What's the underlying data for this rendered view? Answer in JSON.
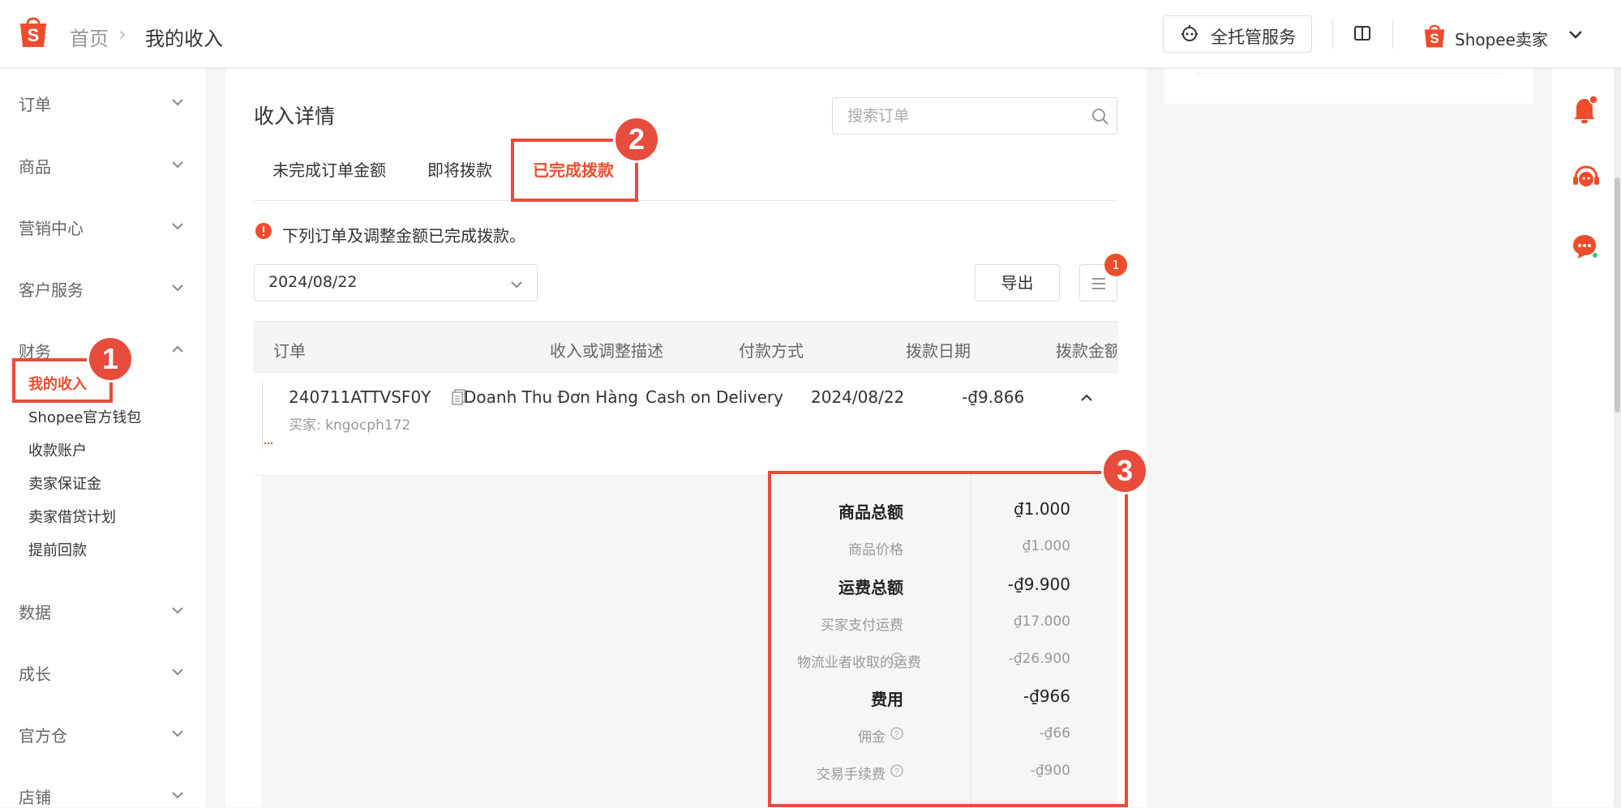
{
  "header": {
    "breadcrumb_home": "首页",
    "breadcrumb_sep": "›",
    "breadcrumb_current": "我的收入",
    "managed_service_label": "全托管服务",
    "shop_name": "Shopee卖家",
    "brand_color": "#ee4d2d"
  },
  "sidebar": {
    "items": [
      {
        "label": "订单"
      },
      {
        "label": "商品"
      },
      {
        "label": "营销中心"
      },
      {
        "label": "客户服务"
      },
      {
        "label": "财务"
      },
      {
        "label": "数据"
      },
      {
        "label": "成长"
      },
      {
        "label": "官方仓"
      },
      {
        "label": "店铺"
      }
    ],
    "finance_sub": [
      {
        "label": "我的收入",
        "active": true
      },
      {
        "label": "Shopee官方钱包"
      },
      {
        "label": "收款账户"
      },
      {
        "label": "卖家保证金"
      },
      {
        "label": "卖家借贷计划"
      },
      {
        "label": "提前回款"
      }
    ]
  },
  "main": {
    "title": "收入详情",
    "search_placeholder": "搜索订单",
    "tabs": [
      {
        "label": "未完成订单金额"
      },
      {
        "label": "即将拨款"
      },
      {
        "label": "已完成拨款",
        "active": true
      }
    ],
    "info_text": "下列订单及调整金额已完成拨款。",
    "date_value": "2024/08/22",
    "export_label": "导出",
    "filter_badge": "1",
    "table": {
      "headers": [
        "订单",
        "收入或调整描述",
        "付款方式",
        "拨款日期",
        "拨款金额"
      ],
      "row": {
        "order_id": "240711ATTVSF0Y",
        "buyer": "买家: kngocph172",
        "description": "Doanh Thu Đơn Hàng",
        "payment": "Cash on Delivery",
        "date": "2024/08/22",
        "amount": "-₫9.866"
      }
    },
    "details": [
      {
        "label": "商品总额",
        "value": "₫1.000",
        "bold": true
      },
      {
        "label": "商品价格",
        "value": "₫1.000"
      },
      {
        "label": "运费总额",
        "value": "-₫9.900",
        "bold": true
      },
      {
        "label": "买家支付运费",
        "value": "₫17.000"
      },
      {
        "label": "物流业者收取的运费",
        "value": "-₫26.900",
        "help": true
      },
      {
        "label": "费用",
        "value": "-₫966",
        "bold": true
      },
      {
        "label": "佣金",
        "value": "-₫66",
        "help": true
      },
      {
        "label": "交易手续费",
        "value": "-₫900",
        "help": true
      }
    ]
  },
  "annotations": {
    "one": "1",
    "two": "2",
    "three": "3",
    "color": "#e74c3c"
  }
}
